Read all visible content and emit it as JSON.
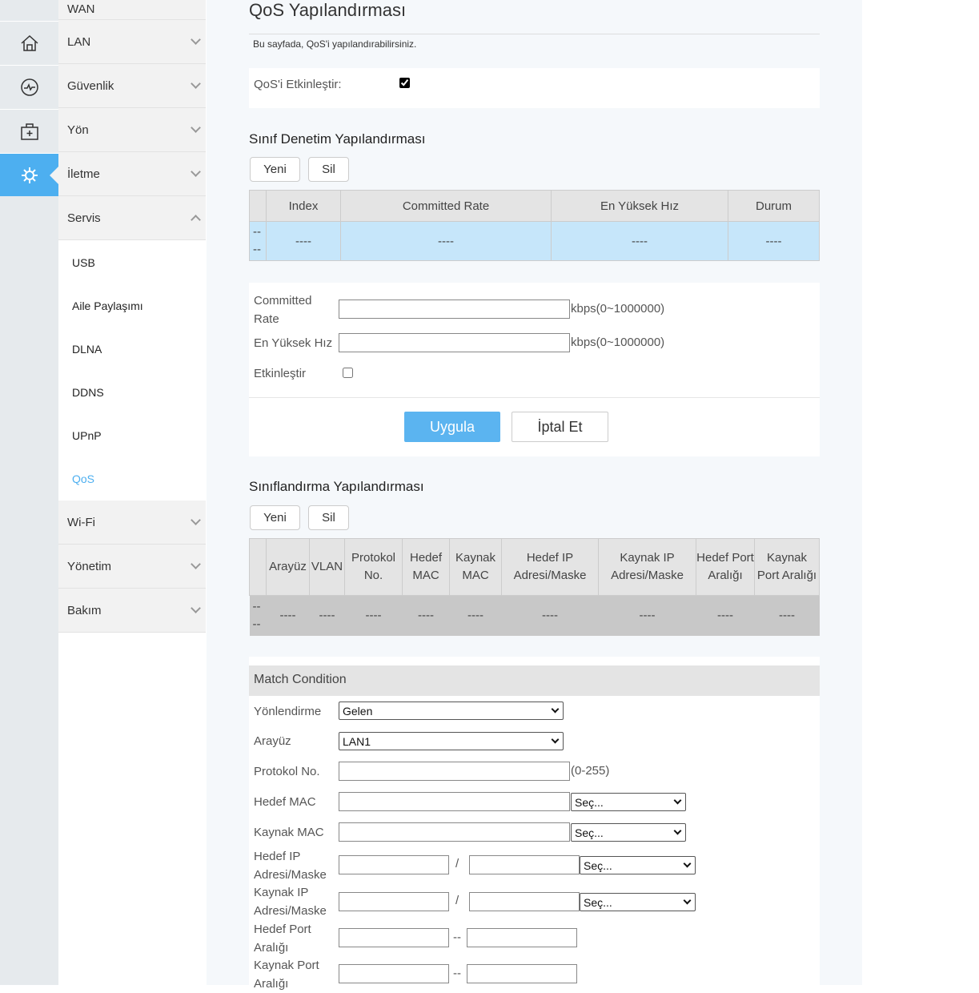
{
  "sidebar": {
    "icons": [
      "home-icon",
      "status-icon",
      "toolbox-icon",
      "gear-icon"
    ],
    "menu": [
      {
        "label": "WAN"
      },
      {
        "label": "LAN"
      },
      {
        "label": "Güvenlik"
      },
      {
        "label": "Yön"
      },
      {
        "label": "İletme"
      },
      {
        "label": "Servis"
      },
      {
        "label": "Wi-Fi"
      },
      {
        "label": "Yönetim"
      },
      {
        "label": "Bakım"
      }
    ],
    "submenu": [
      {
        "label": "USB"
      },
      {
        "label": "Aile Paylaşımı"
      },
      {
        "label": "DLNA"
      },
      {
        "label": "DDNS"
      },
      {
        "label": "UPnP"
      },
      {
        "label": "QoS"
      }
    ]
  },
  "page": {
    "title": "QoS Yapılandırması",
    "description": "Bu sayfada, QoS'i yapılandırabilirsiniz.",
    "enable_label": "QoS'i Etkinleştir:",
    "enable_checked": true
  },
  "policing": {
    "title": "Sınıf Denetim Yapılandırması",
    "new": "Yeni",
    "delete": "Sil",
    "columns": [
      "Index",
      "Committed Rate",
      "En Yüksek Hız",
      "Durum"
    ],
    "row_marker": "--\n--",
    "row": [
      "----",
      "----",
      "----",
      "----"
    ],
    "committed_label": "Committed Rate",
    "committed_unit": "kbps(0~1000000)",
    "peak_label": "En Yüksek Hız",
    "peak_unit": "kbps(0~1000000)",
    "enable_label": "Etkinleştir",
    "enable_checked": false,
    "apply": "Uygula",
    "cancel": "İptal Et"
  },
  "classification": {
    "title": "Sınıflandırma Yapılandırması",
    "new": "Yeni",
    "delete": "Sil",
    "columns": [
      "Arayüz",
      "VLAN",
      "Protokol No.",
      "Hedef MAC",
      "Kaynak MAC",
      "Hedef IP Adresi/Maske",
      "Kaynak IP Adresi/Maske",
      "Hedef Port Aralığı",
      "Kaynak Port Aralığı"
    ],
    "row": [
      "----",
      "----",
      "----",
      "----",
      "----",
      "----",
      "----",
      "----",
      "----"
    ],
    "match_title": "Match Condition",
    "direction_label": "Yönlendirme",
    "direction_value": "Gelen",
    "interface_label": "Arayüz",
    "interface_value": "LAN1",
    "protocol_label": "Protokol No.",
    "protocol_unit": "(0-255)",
    "dst_mac_label": "Hedef MAC",
    "src_mac_label": "Kaynak MAC",
    "select_placeholder": "Seç...",
    "dst_ip_label": "Hedef IP Adresi/Maske",
    "src_ip_label": "Kaynak IP Adresi/Maske",
    "slash": "/",
    "dst_port_label": "Hedef Port Aralığı",
    "src_port_label": "Kaynak Port Aralığı",
    "dash": "--"
  },
  "colors": {
    "accent": "#4daff0"
  }
}
